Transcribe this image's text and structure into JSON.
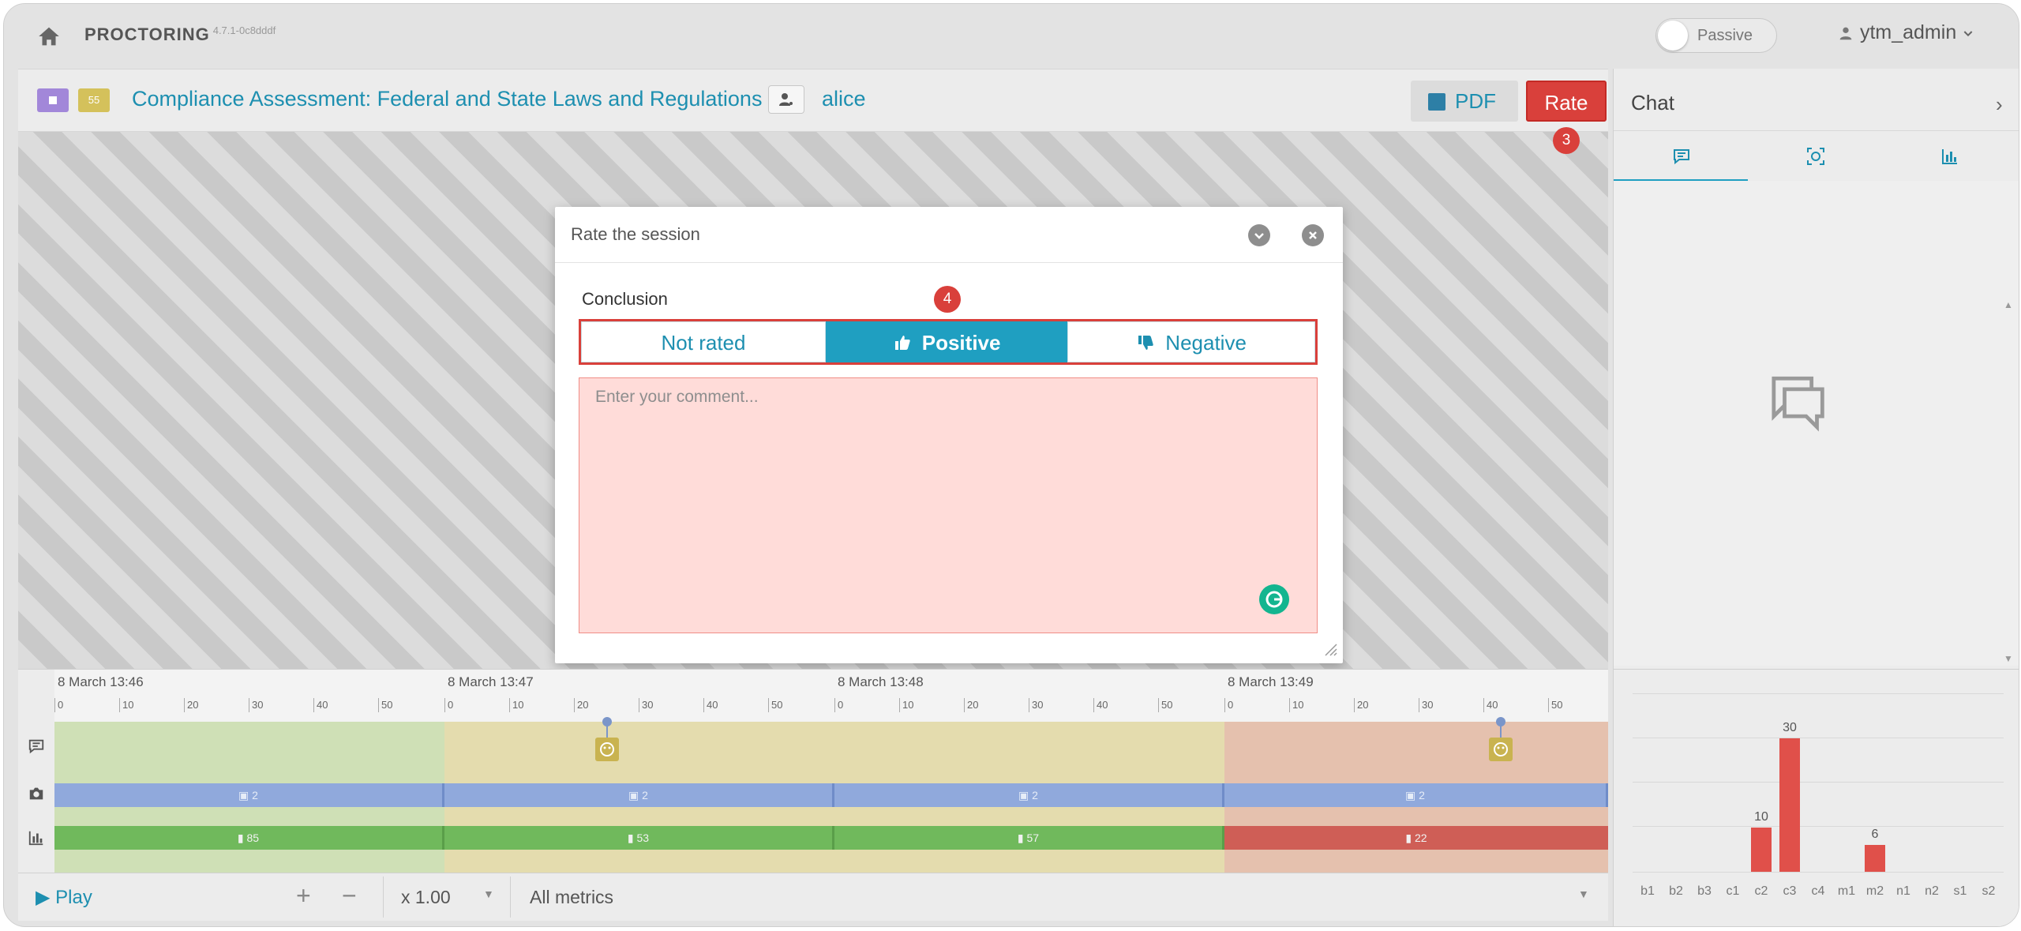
{
  "app": {
    "brand": "PROCTORING",
    "version": "4.7.1-0c8dddf",
    "passive_label": "Passive",
    "username": "ytm_admin"
  },
  "header": {
    "tag_yellow": "55",
    "exam_title": "Compliance Assessment: Federal and State Laws and Regulations",
    "student_name": "alice",
    "pdf_label": "PDF",
    "rate_label": "Rate",
    "step_marker": "3"
  },
  "dialog": {
    "title": "Rate the session",
    "conclusion_label": "Conclusion",
    "step_marker": "4",
    "options": [
      {
        "label": "Not rated",
        "selected": false
      },
      {
        "label": "Positive",
        "selected": true
      },
      {
        "label": "Negative",
        "selected": false
      }
    ],
    "comment_placeholder": "Enter your comment...",
    "comment_value": ""
  },
  "timeline": {
    "segments": [
      {
        "label": "8 March 13:46",
        "ticks": [
          "0",
          "10",
          "20",
          "30",
          "40",
          "50"
        ],
        "camera": "2",
        "metric": "85",
        "status": "good"
      },
      {
        "label": "8 March 13:47",
        "ticks": [
          "0",
          "10",
          "20",
          "30",
          "40",
          "50"
        ],
        "camera": "2",
        "metric": "53",
        "status": "warning"
      },
      {
        "label": "8 March 13:48",
        "ticks": [
          "0",
          "10",
          "20",
          "30",
          "40",
          "50"
        ],
        "camera": "2",
        "metric": "57",
        "status": "warning"
      },
      {
        "label": "8 March 13:49",
        "ticks": [
          "0",
          "10",
          "20",
          "30",
          "40",
          "50"
        ],
        "camera": "2",
        "metric": "22",
        "status": "bad"
      }
    ]
  },
  "controls": {
    "play_label": "Play",
    "zoom_in": "+",
    "zoom_out": "−",
    "speed": "x 1.00",
    "metrics_filter": "All metrics"
  },
  "right_panel": {
    "title": "Chat",
    "tabs": [
      "chat-icon",
      "face-icon",
      "bar-chart-icon"
    ]
  },
  "chart_data": {
    "type": "bar",
    "categories": [
      "b1",
      "b2",
      "b3",
      "c1",
      "c2",
      "c3",
      "c4",
      "m1",
      "m2",
      "n1",
      "n2",
      "s1",
      "s2"
    ],
    "values": [
      0,
      0,
      0,
      0,
      10,
      30,
      0,
      0,
      6,
      0,
      0,
      0,
      0
    ],
    "ylim": [
      0,
      40
    ],
    "grid": true,
    "color": "#e0504a"
  },
  "colors": {
    "accent": "#1f9fc1",
    "danger": "#d9403b",
    "good": "#70b95c",
    "bad": "#cf5e56"
  }
}
